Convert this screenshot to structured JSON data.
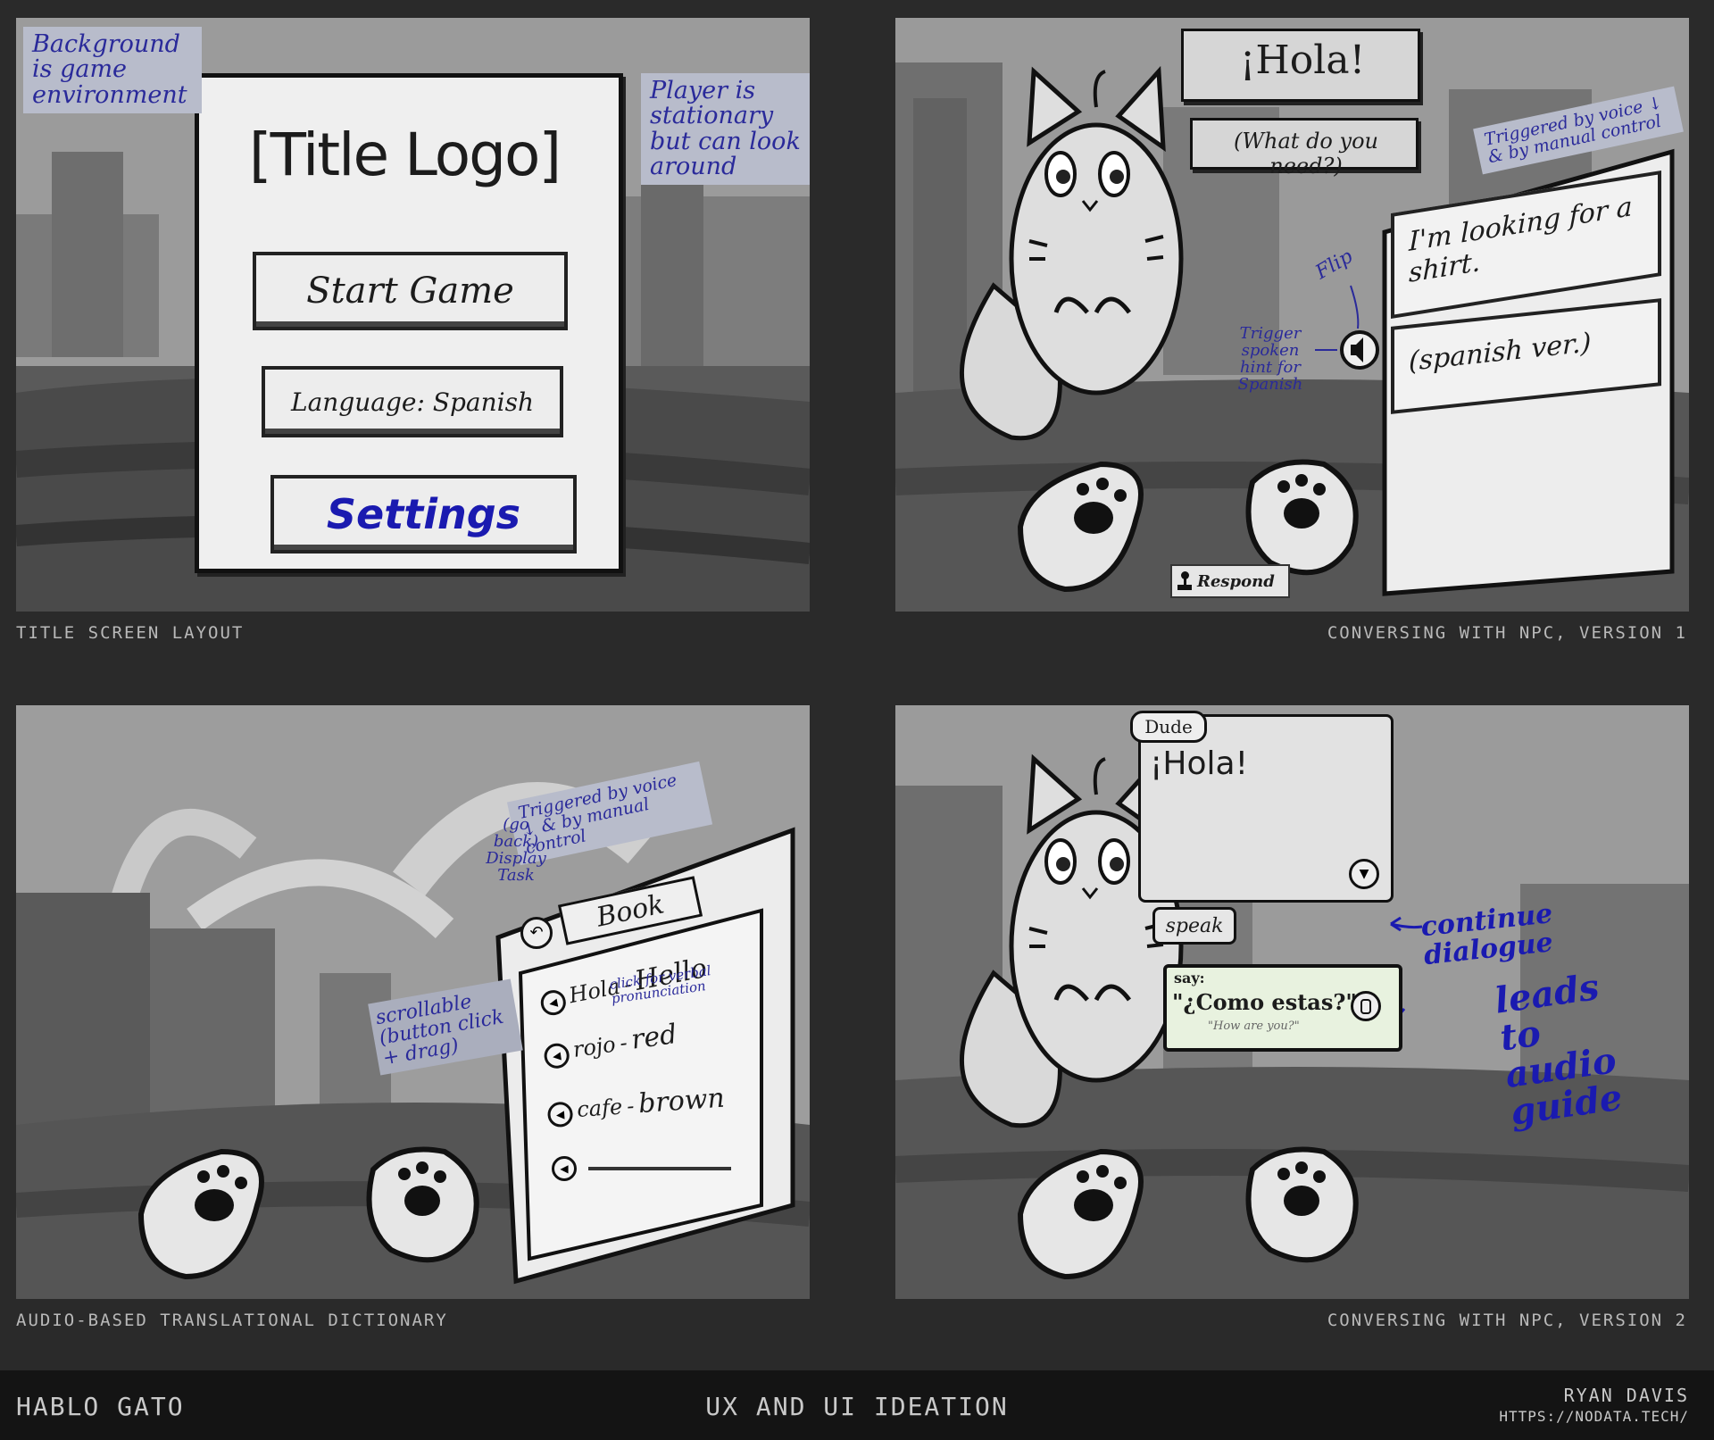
{
  "panel1": {
    "caption": "Title screen layout",
    "note_background": "Background is game environment",
    "note_player": "Player is stationary but can look around",
    "title_logo": "[Title Logo]",
    "start_button": "Start Game",
    "language_button": "Language: Spanish",
    "settings_button": "Settings"
  },
  "panel2": {
    "caption": "Conversing with NPC, Version 1",
    "npc_greeting": "¡Hola!",
    "npc_question": "(What do you need?)",
    "note_triggered": "Triggered by voice ↓ & by manual control",
    "option_english": "I'm looking for a shirt.",
    "option_spanish": "(spanish ver.)",
    "note_flip": "Flip",
    "note_trigger_hint": "Trigger spoken hint for Spanish",
    "respond_label": "Respond"
  },
  "panel3": {
    "caption": "Audio-based translational dictionary",
    "note_triggered": "Triggered by voice ↓ & by manual control",
    "note_go_back": "(go back) Display Task",
    "book_tab": "Book",
    "note_click": "click for verbal pronunciation",
    "note_scrollable": "scrollable (button click + drag)",
    "entries": [
      {
        "es": "Hola",
        "en": "Hello"
      },
      {
        "es": "rojo",
        "en": "red"
      },
      {
        "es": "cafe",
        "en": "brown"
      }
    ]
  },
  "panel4": {
    "caption": "Conversing with NPC, Version 2",
    "speaker": "Dude",
    "dialogue": "¡Hola!",
    "note_continue": "continue dialogue",
    "speak_button": "speak",
    "say_label": "say:",
    "say_phrase": "\"¿Como estas?\"",
    "say_translation": "\"How are you?\"",
    "note_audio": "leads to audio guide"
  },
  "footer": {
    "project": "Hablo Gato",
    "center_title": "UX and UI Ideation",
    "author": "Ryan Davis",
    "url": "https://nodata.tech/"
  },
  "colors": {
    "page_bg": "#2a2a2a",
    "panel_bg": "#9a9a9a",
    "annotation_blue": "#2a2a9a",
    "highlight_blue": "#1a1ab0"
  }
}
